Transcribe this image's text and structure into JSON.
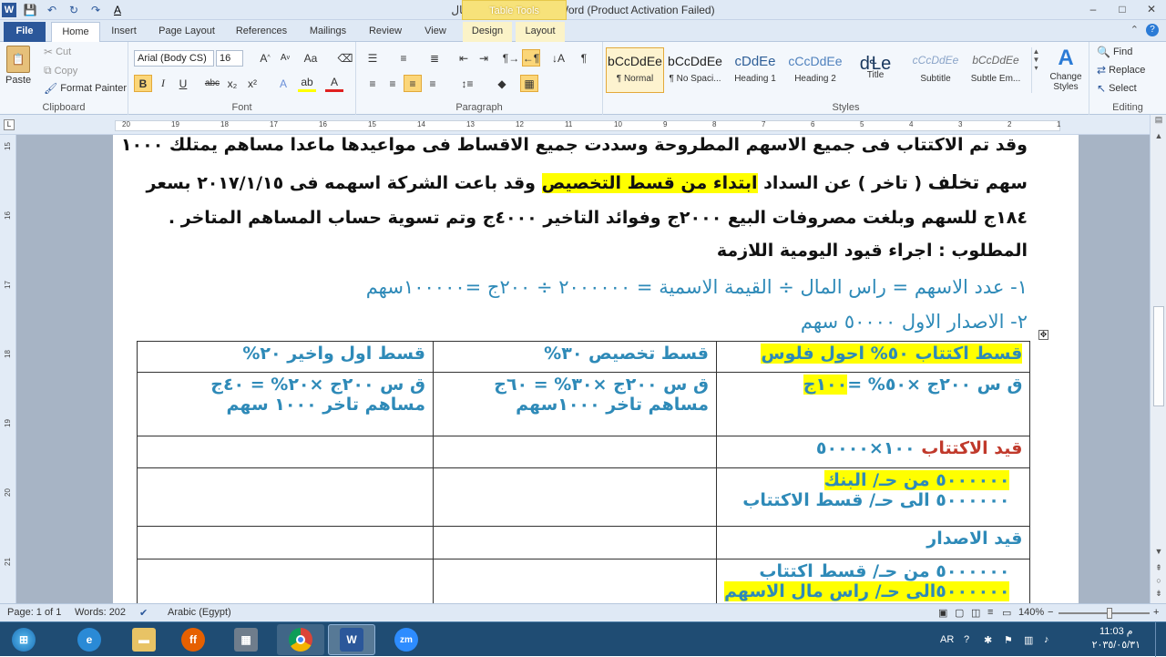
{
  "window": {
    "title": "لایف فاینال  -  Microsoft Word (Product Activation Failed)",
    "context_tab": "Table Tools",
    "min": "–",
    "max": "□",
    "close": "✕"
  },
  "qat": {
    "save": "💾",
    "undo": "↶",
    "redo": "↻",
    "repeat": "↷",
    "font_color": "A"
  },
  "tabs": [
    {
      "label": "File"
    },
    {
      "label": "Home"
    },
    {
      "label": "Insert"
    },
    {
      "label": "Page Layout"
    },
    {
      "label": "References"
    },
    {
      "label": "Mailings"
    },
    {
      "label": "Review"
    },
    {
      "label": "View"
    },
    {
      "label": "Design"
    },
    {
      "label": "Layout"
    }
  ],
  "clipboard": {
    "paste": "Paste",
    "cut": "Cut",
    "copy": "Copy",
    "format_painter": "Format Painter",
    "group": "Clipboard"
  },
  "font": {
    "name": "Arial (Body CS)",
    "size": "16",
    "group": "Font",
    "bold": "B",
    "italic": "I",
    "underline": "U",
    "strike": "abc",
    "sub": "x₂",
    "sup": "x²"
  },
  "paragraph": {
    "group": "Paragraph",
    "pilcrow": "¶"
  },
  "styles": {
    "group": "Styles",
    "items": [
      {
        "sample": "bCcDdEe",
        "name": "¶ Normal"
      },
      {
        "sample": "bCcDdEe",
        "name": "¶ No Spaci..."
      },
      {
        "sample": "cDdEe",
        "name": "Heading 1"
      },
      {
        "sample": "cCcDdEe",
        "name": "Heading 2"
      },
      {
        "sample": "dꞭe",
        "name": "Title"
      },
      {
        "sample": "cCcDdEe",
        "name": "Subtitle"
      },
      {
        "sample": "bCcDdEe",
        "name": "Subtle Em..."
      }
    ],
    "change": "Change Styles"
  },
  "editing": {
    "group": "Editing",
    "find": "Find",
    "replace": "Replace",
    "select": "Select"
  },
  "ruler": {
    "top": [
      "20",
      "19",
      "18",
      "17",
      "16",
      "15",
      "14",
      "13",
      "12",
      "11",
      "10",
      "9",
      "8",
      "7",
      "6",
      "5",
      "4",
      "3",
      "2",
      "1"
    ],
    "left": [
      "15",
      "16",
      "17",
      "18",
      "19",
      "20",
      "21"
    ]
  },
  "document": {
    "line1": "وقد تم الاكتتاب فى جميع الاسهم المطروحة وسددت جميع الاقساط فى مواعيدها ماعدا مساهم يمتلك ١٠٠٠",
    "line2_a": "سهم ",
    "line2_b": "تخلف",
    "line2_c": " ( تاخر )  عن السداد ",
    "line2_hl": "ابتداء من قسط التخصيص",
    "line2_d": " وقد باعت الشركة اسهمه فى ٢٠١٧/١/١٥ بسعر",
    "line3": "١٨٤ج للسهم وبلغت مصروفات البيع ٢٠٠٠ج وفوائد التاخير ٤٠٠٠ج وتم تسوية حساب المساهم المتاخر .",
    "line4": "المطلوب : اجراء قيود اليومية اللازمة",
    "line5": "١- عدد الاسهم = راس المال ÷ القيمة الاسمية = ٢٠٠٠٠٠٠ ÷ ٢٠٠ج =١٠٠٠٠٠سهم",
    "line6": "٢- الاصدار الاول ٥٠٠٠٠ سهم"
  },
  "table": {
    "r1": {
      "c1": "قسط اكتتاب ٥٠% احول فلوس",
      "c2": "قسط تخصيص ٣٠%",
      "c3": "قسط اول واخير  ٢٠%"
    },
    "r2": {
      "c1a": "ق س ٢٠٠ج ×٥٠% =",
      "c1b": "١٠٠ج",
      "c2a": "ق س ٢٠٠ج ×٣٠% = ٦٠ج",
      "c2b": "مساهم تاخر ١٠٠٠سهم",
      "c3a": "ق س ٢٠٠ج ×٢٠% = ٤٠ج",
      "c3b": "مساهم تاخر ١٠٠٠ سهم"
    },
    "r3": {
      "c1a": "قيد الاكتتاب",
      "c1b": " ١٠٠×٥٠٠٠٠"
    },
    "r4": {
      "c1a": "٥٠٠٠٠٠٠ من حـ/ البنك",
      "c1b": "٥٠٠٠٠٠٠  الى حـ/ قسط الاكتتاب"
    },
    "r5": {
      "c1": "قيد الاصدار"
    },
    "r6": {
      "c1a": "٥٠٠٠٠٠٠ من حـ/ قسط اكتتاب",
      "c1b": "٥٠٠٠٠٠٠الى حـ/ راس مال الاسهم"
    }
  },
  "status": {
    "page": "Page: 1 of 1",
    "words": "Words: 202",
    "language": "Arabic (Egypt)",
    "zoom": "140%",
    "zoom_level_percent": 140
  },
  "taskbar": {
    "apps": [
      "start",
      "ie",
      "explorer",
      "firefox",
      "calculator",
      "chrome",
      "word",
      "zoom"
    ],
    "lang": "AR",
    "time": "11:03 م",
    "date": "٢٠٣٥/٠٥/٣١"
  }
}
